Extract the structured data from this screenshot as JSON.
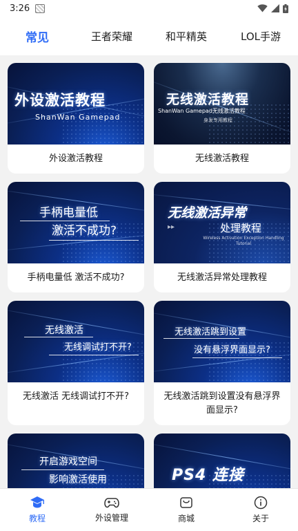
{
  "status_bar": {
    "time": "3:26"
  },
  "top_tabs": [
    {
      "label": "常见",
      "active": true
    },
    {
      "label": "王者荣耀",
      "active": false
    },
    {
      "label": "和平精英",
      "active": false
    },
    {
      "label": "LOL手游",
      "active": false
    }
  ],
  "cards": [
    {
      "label": "外设激活教程",
      "thumb_title": "外设激活教程",
      "thumb_subtitle": "ShanWan Gamepad"
    },
    {
      "label": "无线激活教程",
      "thumb_title": "无线激活教程",
      "thumb_subtitle": "ShanWan Gamepad无线激活教程",
      "thumb_caption": "身发专用教程"
    },
    {
      "label": "手柄电量低 激活不成功?",
      "thumb_line1": "手柄电量低",
      "thumb_line2": "激活不成功?"
    },
    {
      "label": "无线激活异常处理教程",
      "thumb_line1": "无线激活异常",
      "thumb_line2": "处理教程",
      "thumb_caption": "Wireless Activation Exception Handling Tutorial"
    },
    {
      "label": "无线激活 无线调试打不开?",
      "thumb_line1": "无线激活",
      "thumb_line2": "无线调试打不开?"
    },
    {
      "label": "无线激活跳到设置没有悬浮界面显示?",
      "thumb_line1": "无线激活跳到设置",
      "thumb_line2": "没有悬浮界面显示?"
    },
    {
      "label": "",
      "thumb_line1": "开启游戏空间",
      "thumb_line2": "影响激活使用"
    },
    {
      "label": "",
      "thumb_line1": "PS4 连接"
    }
  ],
  "bottom_nav": [
    {
      "label": "教程",
      "icon": "graduation-cap-icon",
      "active": true
    },
    {
      "label": "外设管理",
      "icon": "gamepad-icon",
      "active": false
    },
    {
      "label": "商城",
      "icon": "shopping-bag-icon",
      "active": false
    },
    {
      "label": "关于",
      "icon": "info-icon",
      "active": false
    }
  ],
  "colors": {
    "accent": "#2f6cf6",
    "content_bg": "#f2f2f2",
    "thumb_dark": "#0a1f55"
  }
}
